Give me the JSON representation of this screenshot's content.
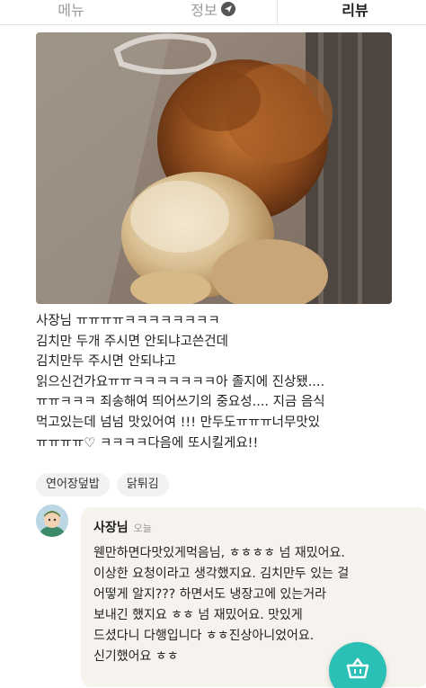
{
  "tabs": {
    "menu": "메뉴",
    "info": "정보",
    "review": "리뷰"
  },
  "review": {
    "lines": [
      "사장님 ㅠㅠㅠㅠㅋㅋㅋㅋㅋㅋㅋㅋ",
      "김치만 두개 주시면 안되냐고쓴건데",
      "김치만두 주시면 안되냐고",
      "읽으신건가요ㅠㅠㅋㅋㅋㅋㅋㅋㅋ아 졸지에 진상됐....",
      "ㅠㅠㅋㅋㅋ 죄송해여 띄어쓰기의 중요성.... 지금 음식",
      "먹고있는데 넘넘 맛있어여 !!! 만두도ㅠㅠㅠ너무맛있",
      "ㅠㅠㅠㅠ♡ ㅋㅋㅋㅋ다음에 또시킬게요!!"
    ],
    "tags": [
      "연어장덮밥",
      "닭튀김"
    ]
  },
  "reply": {
    "owner": "사장님",
    "time": "오늘",
    "lines": [
      "웬만하면다맛있게먹음님, ㅎㅎㅎㅎ 넘 재밌어요.",
      "이상한 요청이라고 생각했지요. 김치만두 있는 걸",
      "어떻게 알지??? 하면서도 냉장고에 있는거라",
      "보내긴 했지요 ㅎㅎ 넘 재밌어요. 맛있게",
      "드셨다니 다행입니다 ㅎㅎ진상아니었어요.",
      "신기했어요 ㅎㅎ"
    ]
  },
  "colors": {
    "accent": "#2bc0b6",
    "bubble": "#f6f3ee",
    "chip": "#f2f2f2"
  }
}
